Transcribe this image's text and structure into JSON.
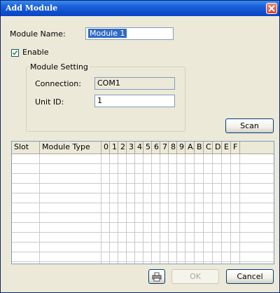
{
  "window": {
    "title": "Add Module"
  },
  "form": {
    "module_name_label": "Module Name:",
    "module_name_value": "Module 1",
    "enable_label": "Enable",
    "enable_checked": true
  },
  "module_setting": {
    "legend": "Module Setting",
    "connection_label": "Connection:",
    "connection_value": "COM1",
    "unit_id_label": "Unit ID:",
    "unit_id_value": "1"
  },
  "buttons": {
    "scan": "Scan",
    "ok": "OK",
    "cancel": "Cancel"
  },
  "table": {
    "columns": [
      "Slot",
      "Module Type",
      "0",
      "1",
      "2",
      "3",
      "4",
      "5",
      "6",
      "7",
      "8",
      "9",
      "A.",
      "B",
      "C.",
      "D.",
      "E",
      "F"
    ],
    "rows": []
  },
  "icons": {
    "close": "close-icon",
    "printer": "printer-icon",
    "check": "checkmark-icon"
  }
}
